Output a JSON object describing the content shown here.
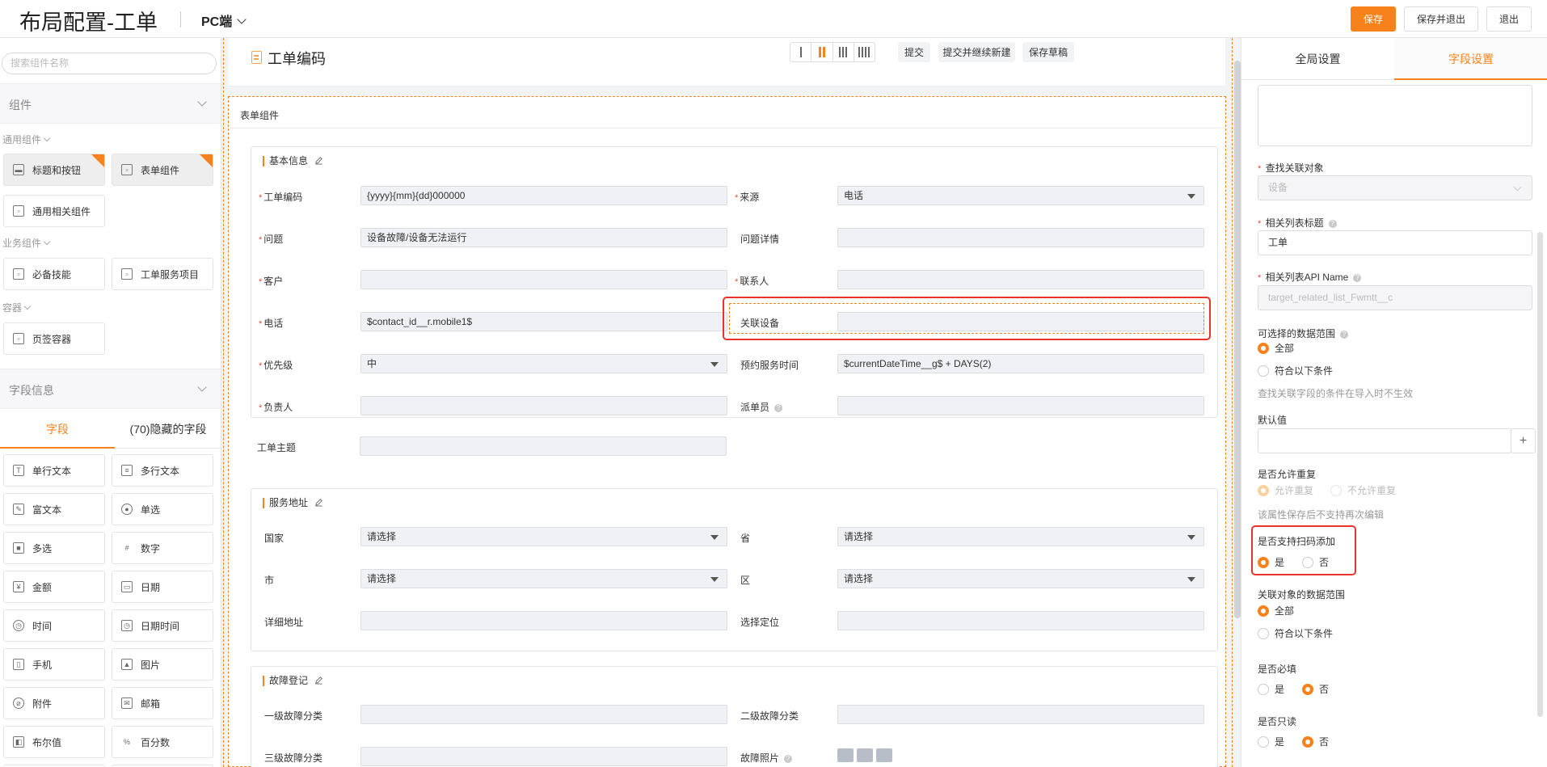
{
  "header": {
    "title": "布局配置-工单",
    "platform": "PC端",
    "save": "保存",
    "save_exit": "保存并退出",
    "exit": "退出"
  },
  "left": {
    "search_placeholder": "搜索组件名称",
    "components_section": "组件",
    "groups": {
      "common": "通用组件",
      "business": "业务组件",
      "container": "容器"
    },
    "common_items": [
      "标题和按钮",
      "表单组件",
      "通用相关组件"
    ],
    "business_items": [
      "必备技能",
      "工单服务项目"
    ],
    "container_items": [
      "页签容器"
    ],
    "field_section": "字段信息",
    "field_tabs": [
      "字段",
      "(70)隐藏的字段"
    ],
    "field_types": [
      "单行文本",
      "多行文本",
      "富文本",
      "单选",
      "多选",
      "数字",
      "金额",
      "日期",
      "时间",
      "日期时间",
      "手机",
      "图片",
      "附件",
      "邮箱",
      "布尔值",
      "百分数"
    ]
  },
  "canvas": {
    "header_title": "工单编码",
    "buttons": [
      "提交",
      "提交并继续新建",
      "保存草稿"
    ],
    "form_title": "表单组件",
    "sections": [
      {
        "title": "基本信息"
      },
      {
        "title": "服务地址"
      },
      {
        "title": "故障登记"
      }
    ],
    "basic": {
      "code_label": "工单编码",
      "code_value": "{yyyy}{mm}{dd}000000",
      "source_label": "来源",
      "source_value": "电话",
      "problem_label": "问题",
      "problem_value": "设备故障/设备无法运行",
      "problem_detail_label": "问题详情",
      "customer_label": "客户",
      "contact_label": "联系人",
      "phone_label": "电话",
      "phone_value": "$contact_id__r.mobile1$",
      "device_label": "关联设备",
      "priority_label": "优先级",
      "priority_value": "中",
      "appt_label": "预约服务时间",
      "appt_value": "$currentDateTime__g$ + DAYS(2)",
      "owner_label": "负责人",
      "dispatcher_label": "派单员",
      "subject_label": "工单主题"
    },
    "address": {
      "country_label": "国家",
      "country_value": "请选择",
      "province_label": "省",
      "province_value": "请选择",
      "city_label": "市",
      "city_value": "请选择",
      "district_label": "区",
      "district_value": "请选择",
      "detail_label": "详细地址",
      "locate_label": "选择定位"
    },
    "fault": {
      "cat1_label": "一级故障分类",
      "cat2_label": "二级故障分类",
      "cat3_label": "三级故障分类",
      "photo_label": "故障照片"
    }
  },
  "right": {
    "tabs": [
      "全局设置",
      "字段设置"
    ],
    "lookup_label": "查找关联对象",
    "lookup_value": "设备",
    "list_title_label": "相关列表标题",
    "list_title_value": "工单",
    "api_label": "相关列表API Name",
    "api_value": "target_related_list_Fwmtt__c",
    "range_label": "可选择的数据范围",
    "range_all": "全部",
    "range_cond": "符合以下条件",
    "range_hint": "查找关联字段的条件在导入时不生效",
    "default_label": "默认值",
    "default_add": "+",
    "dup_label": "是否允许重复",
    "dup_yes": "允许重复",
    "dup_no": "不允许重复",
    "dup_hint": "该属性保存后不支持再次编辑",
    "scan_label": "是否支持扫码添加",
    "scan_yes": "是",
    "scan_no": "否",
    "rel_range_label": "关联对象的数据范围",
    "rel_all": "全部",
    "rel_cond": "符合以下条件",
    "required_label": "是否必填",
    "required_yes": "是",
    "required_no": "否",
    "readonly_label": "是否只读",
    "readonly_yes": "是",
    "readonly_no": "否"
  },
  "colors": {
    "accent": "#f7821b",
    "highlight": "#e8352b",
    "required": "#f0483e"
  }
}
